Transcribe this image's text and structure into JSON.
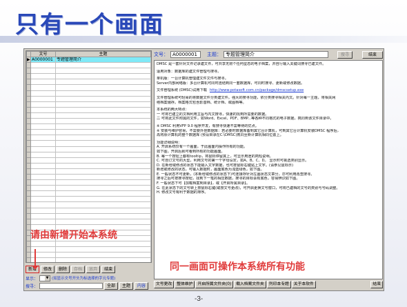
{
  "slide": {
    "title": "只有一个画面",
    "page_number": "-3-",
    "annotation_left": "请由新增开始本系统",
    "annotation_right": "同一画面可操作本系统所有功能",
    "accent_color": "#2948b8",
    "annotation_color": "#e03a3a"
  },
  "grid": {
    "col_no": "文号",
    "col_subject": "主题",
    "rows": [
      {
        "no": "A0000001",
        "subject": "专题管理简介",
        "selected": true
      }
    ],
    "empty_rows": 36
  },
  "left_buttons": {
    "add": "新增",
    "edit": "修改",
    "delete": "删除",
    "save": "存档",
    "cancel": "放弃",
    "close": "结束"
  },
  "display_row": {
    "label": "显示：",
    "combo_value": "",
    "hint": "(如显示文号开头为标选择的字元专题)"
  },
  "search_row": {
    "label": "搜寻：",
    "input_value": "",
    "all": "全部",
    "subject": "主题",
    "content": "内容"
  },
  "top_bar": {
    "no_label": "文号：",
    "no_value": "A0000001",
    "subject_label": "主题：",
    "subject_value": "专题管理简介",
    "search_btn": "搜寻",
    "close_btn": "结束"
  },
  "document": {
    "lines": [
      "DMSC 是一套针对文件记录建文件，可共享无限个任何型态的电子档案，并自行输入关键词搜寻已建文件。",
      "",
      "适用对象：数据库的建文件管理与搜寻。",
      "",
      "单机版：一台计算机管理建文件文件与搜寻。",
      "Server内部网络版：多台计算机可同时连结到同一套数据库，可同时搜寻、更新或修改数据。",
      "",
      "文件管理系统 (DMSC)试用下载",
      "",
      "文件管理系统可轻易的将数据文件分类建文件。强大的搜寻功能，依分类搜寻相关内文。针对每一主题，将相关网",
      "络档案储存。档案格式包含影音档、统计档、或图档等。",
      "",
      "本系统的两大特点：",
      "一  可将已建立的文档利用主旨与内文搜寻，快速的找到所需要的数据。",
      "二  可将此文件附属的文件，如Word、Excel、PDF、BMP...等各种不同格式的电子数据，携同到该文件目录中。",
      "",
      "※ DMSC 利用VFP 9.0 程序开发，有搜寻快速不需等待的优点。",
      "※ 安装与维护容易，不需要外挂数据库：若必要时数据库备到其它台计算机，可到其它台计算机安装DMSC 程序后，",
      "再将原计算机的整个数据库 (预设目录在C:\\DMSC)携同至新计算机相同位置上。",
      "",
      "功能详细说明：",
      "A. 开启系统仅有一个画面，于此画面内操作所有的功能。",
      "如下图，开启后就可看到所有的功能画面。",
      "B. 每一个按钮上都有tooltip，将鼠标停留其上，可显示用途的简短说明。",
      "C. 可自订文号的大型，利用文号的第一个字母设定，如A、B、C、D。     显示时可挑选类别显示。",
      "D. 在新增或修改的状态下能输入文字数据，也可按鼠标右键贴上文字。(请参见鼠标示)",
      "新增或修改的状态，可输入数据时，画面底色为浅蓝绿色，如下图。",
      "E. 一般状态不可更新，(本新增或修改的状态下)可连接存针对左画状态文章分，亦可利用再查搜寻。",
      "搜寻之后可按搜寻按纽，找到下一笔的相应数据，搜寻的目标会有底色，容易辨识如下图。",
      "F. 一般状态下可【加载档案到目录】，或【开启所属目录】。",
      "G. 在此状态下的文号转上按鼠标右键(或按文号更改)，可开启更换文号窗口，可将已建档的文号的类别与号码调整。",
      "H. 修改文号有利于数据的排序。"
    ],
    "link_text": "http://www.potasoft.com.cn/package/dmscsetup.exe"
  },
  "bottom_buttons": [
    "文号更改",
    "整体维护",
    "开启所属文件夹(0)",
    "载入档案文件夹",
    "列印本专题",
    "关于本软件",
    "结束"
  ]
}
